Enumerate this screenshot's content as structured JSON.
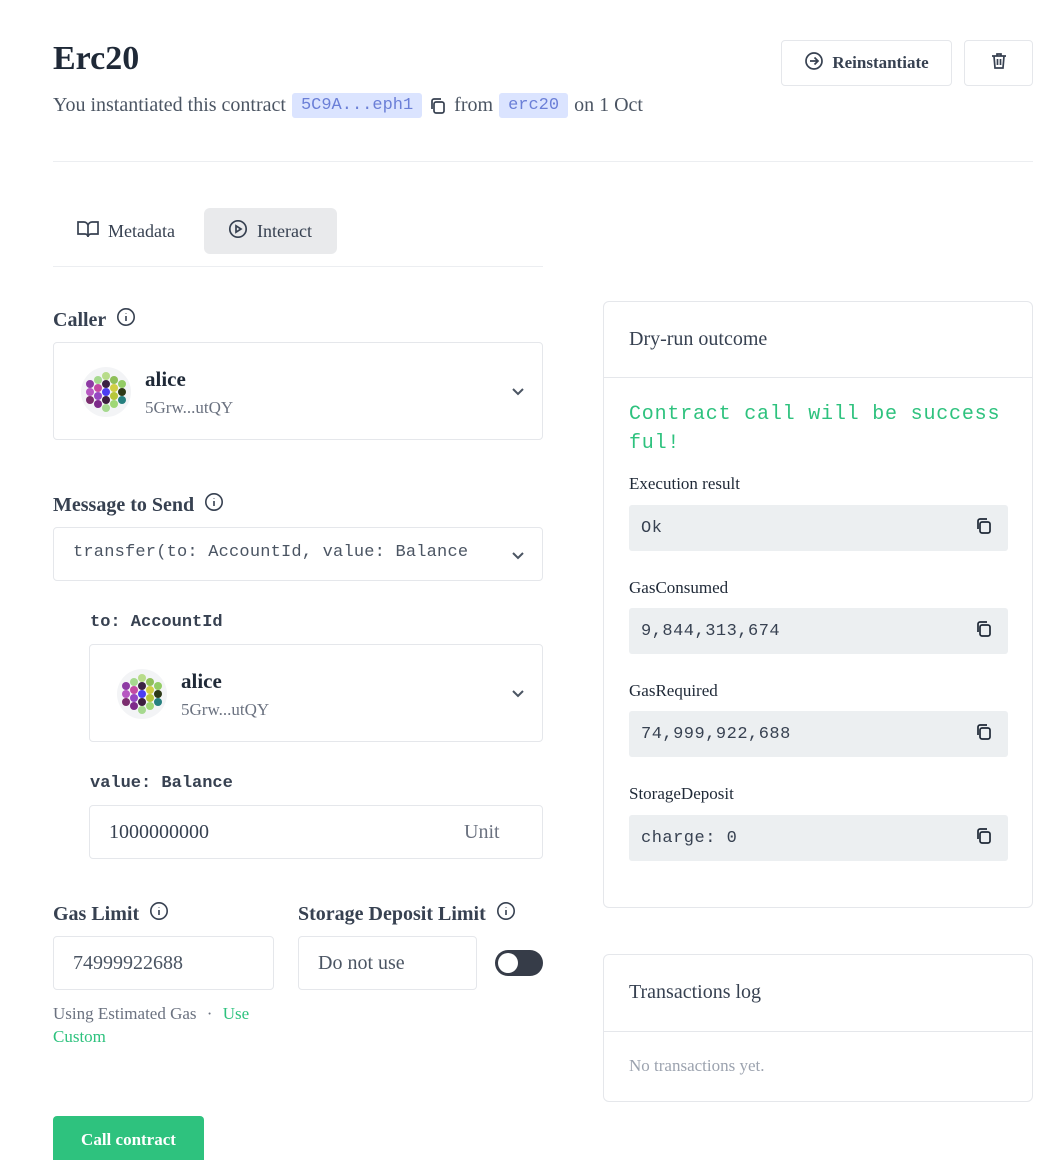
{
  "header": {
    "title": "Erc20",
    "subtitle_prefix": "You instantiated this contract",
    "address_chip": "5C9A...eph1",
    "from_text": "from",
    "code_chip": "erc20",
    "date_text": "on 1 Oct",
    "reinstantiate_label": "Reinstantiate",
    "icons": {
      "reinstantiate": "arrow-right-circle-icon",
      "delete": "trash-icon",
      "copy": "copy-icon"
    }
  },
  "tabs": [
    {
      "label": "Metadata",
      "icon": "book-open-icon",
      "active": false
    },
    {
      "label": "Interact",
      "icon": "play-circle-icon",
      "active": true
    }
  ],
  "caller": {
    "label": "Caller",
    "name": "alice",
    "address": "5Grw...utQY"
  },
  "message": {
    "label": "Message to Send",
    "selected": "transfer(to: AccountId, value: Balance"
  },
  "args": {
    "to_label": "to: AccountId",
    "to_name": "alice",
    "to_address": "5Grw...utQY",
    "value_label": "value: Balance",
    "value": "1000000000",
    "unit": "Unit"
  },
  "gas": {
    "label": "Gas Limit",
    "value": "74999922688",
    "note": "Using Estimated Gas",
    "separator": "·",
    "link": "Use Custom"
  },
  "storage": {
    "label": "Storage Deposit Limit",
    "value": "Do not use",
    "toggle_on": false
  },
  "call_button": "Call contract",
  "dry_run": {
    "title": "Dry-run outcome",
    "status": "Contract call will be successful!",
    "results": [
      {
        "label": "Execution result",
        "value": "Ok"
      },
      {
        "label": "GasConsumed",
        "value": "9,844,313,674"
      },
      {
        "label": "GasRequired",
        "value": "74,999,922,688"
      },
      {
        "label": "StorageDeposit",
        "value": "charge: 0"
      }
    ]
  },
  "tx_log": {
    "title": "Transactions log",
    "empty": "No transactions yet."
  },
  "colors": {
    "accent": "#2ec27e",
    "chip_bg": "#dbe4ff",
    "chip_text": "#6b7fd7",
    "toggle": "#363c48"
  }
}
